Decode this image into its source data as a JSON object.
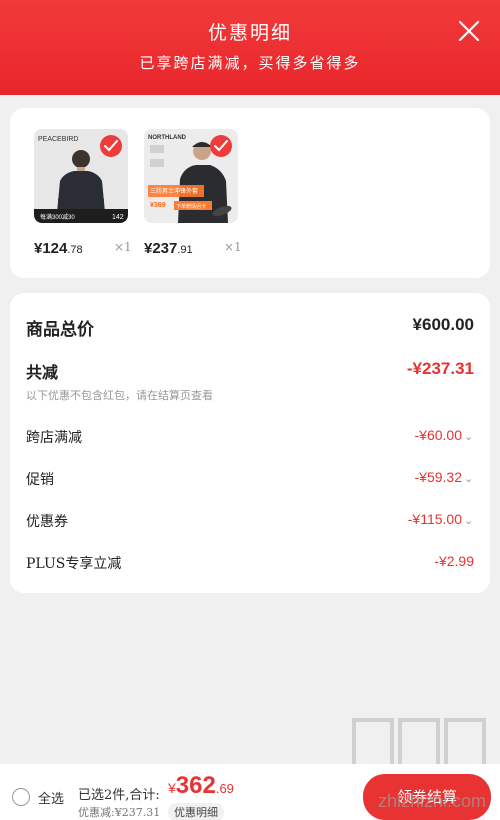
{
  "header": {
    "title": "优惠明细",
    "subtitle": "已享跨店满减，买得多省得多"
  },
  "products": [
    {
      "brand": "PEACEBIRD",
      "price_int": "¥124",
      "price_dec": ".78",
      "qty": "×1",
      "badge": "142",
      "promo": "每满300减30"
    },
    {
      "brand": "NORTHLAND",
      "price_int": "¥237",
      "price_dec": ".91",
      "qty": "×1",
      "promo_line1": "三防男士冲锋外套",
      "promo_price": "¥369",
      "promo_line2": "下单赠情侣卡"
    }
  ],
  "summary": {
    "total_label": "商品总价",
    "total_value": "¥600.00",
    "reduce_label": "共减",
    "reduce_value": "-¥237.31",
    "note": "以下优惠不包含红包，请在结算页查看",
    "items": [
      {
        "label": "跨店满减",
        "value": "-¥60.00"
      },
      {
        "label": "促销",
        "value": "-¥59.32"
      },
      {
        "label": "优惠券",
        "value": "-¥115.00"
      },
      {
        "label": "PLUS专享立减",
        "value": "-¥2.99"
      }
    ]
  },
  "bottom": {
    "select_all": "全选",
    "selected_text": "已选2件,合计:",
    "total_yen": "¥",
    "total_int": "362",
    "total_dec": ".69",
    "discount_text": "优惠减:¥237.31",
    "detail_button": "优惠明细",
    "checkout_button": "领券结算"
  },
  "watermark": {
    "site": "zhizhizhi.com"
  },
  "colors": {
    "accent": "#e93232",
    "header": "#f23a3a"
  }
}
